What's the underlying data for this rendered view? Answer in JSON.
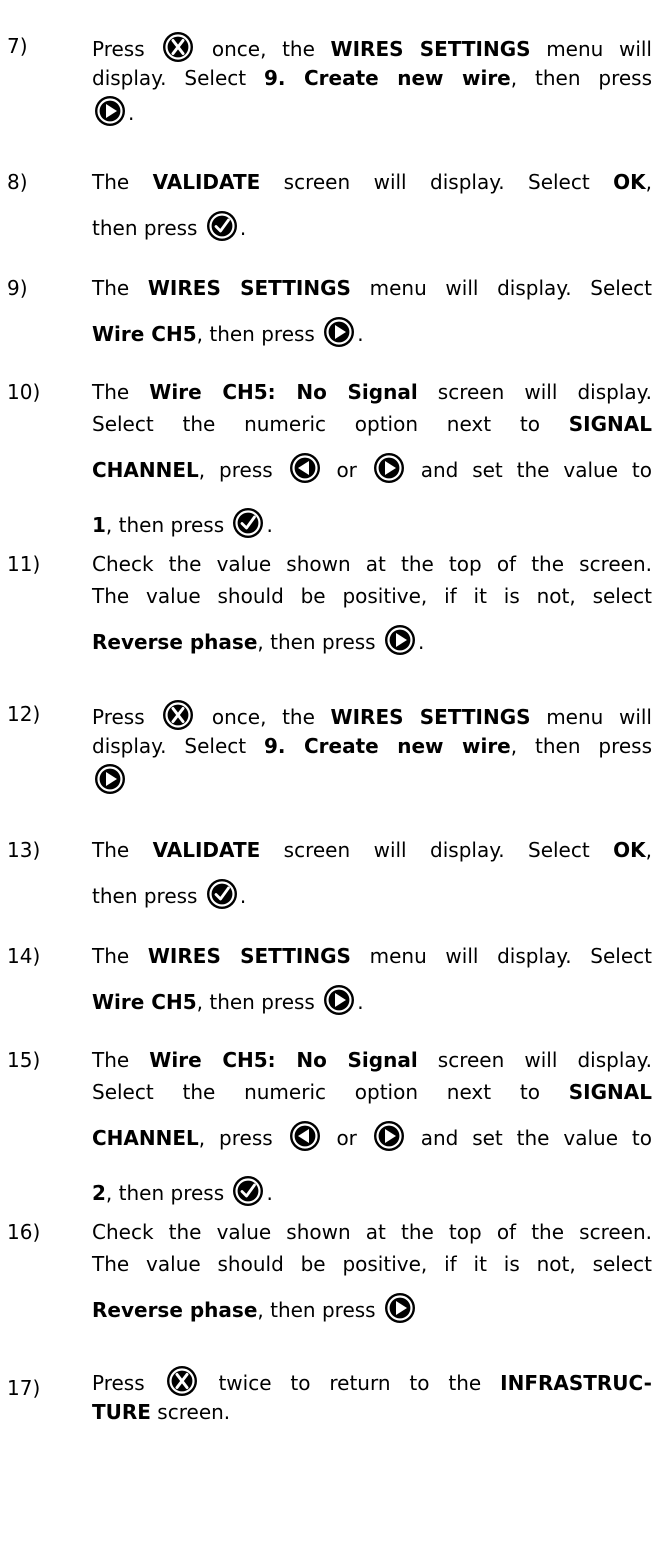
{
  "steps": [
    {
      "num": "7)",
      "a": "Press ",
      "b": " once, the ",
      "c": "WIRES SETTINGS",
      "d": " menu will",
      "e": "display. Select ",
      "f": "9. Create new wire",
      "g": ", then press",
      "h": "."
    },
    {
      "num": "8)",
      "a": "The ",
      "b": "VALIDATE",
      "c": " screen will display. Select ",
      "d": "OK",
      "e": ",",
      "f": "then press ",
      "g": "."
    },
    {
      "num": "9)",
      "a": "The ",
      "b": "WIRES SETTINGS",
      "c": " menu will display. Select",
      "d": "Wire CH5",
      "e": ", then press ",
      "f": "."
    },
    {
      "num": "10)",
      "a": "The ",
      "b": "Wire CH5: No Signal",
      "c": " screen will display.",
      "d": "Select the numeric option next to ",
      "e": "SIGNAL",
      "f": "CHANNEL",
      "g": ", press ",
      "h": " or ",
      "i": " and set the value to",
      "j": "1",
      "k": ", then press ",
      "l": "."
    },
    {
      "num": "11)",
      "a": "Check the value shown at the top of the screen.",
      "b": "The value should be positive, if it is not, select",
      "c": "Reverse phase",
      "d": ", then press ",
      "e": "."
    },
    {
      "num": "12)",
      "a": "Press ",
      "b": " once, the ",
      "c": "WIRES SETTINGS",
      "d": " menu will",
      "e": "display. Select ",
      "f": "9. Create new wire",
      "g": ", then press"
    },
    {
      "num": "13)",
      "a": "The ",
      "b": "VALIDATE",
      "c": " screen will display. Select ",
      "d": "OK",
      "e": ",",
      "f": "then press ",
      "g": "."
    },
    {
      "num": "14)",
      "a": "The ",
      "b": "WIRES SETTINGS",
      "c": " menu will display. Select",
      "d": "Wire CH5",
      "e": ", then press ",
      "f": "."
    },
    {
      "num": "15)",
      "a": "The ",
      "b": "Wire CH5: No Signal",
      "c": " screen will display.",
      "d": "Select the numeric option next to ",
      "e": "SIGNAL",
      "f": "CHANNEL",
      "g": ", press ",
      "h": " or ",
      "i": " and set the value to",
      "j": "2",
      "k": ", then press ",
      "l": "."
    },
    {
      "num": "16)",
      "a": "Check the value shown at the top of the screen.",
      "b": "The value should be positive, if it is not, select",
      "c": "Reverse phase",
      "d": ", then press "
    },
    {
      "num": "17)",
      "a": "Press ",
      "b": " twice to return to the ",
      "c": "INFRASTRUC-",
      "d": "TURE",
      "e": " screen."
    }
  ],
  "icons": {
    "close": "x-button-icon",
    "right": "right-arrow-button-icon",
    "left": "left-arrow-button-icon",
    "check": "check-button-icon"
  },
  "colors": {
    "text": "#000000",
    "icon_fill": "#000000",
    "icon_glyph": "#ffffff"
  }
}
